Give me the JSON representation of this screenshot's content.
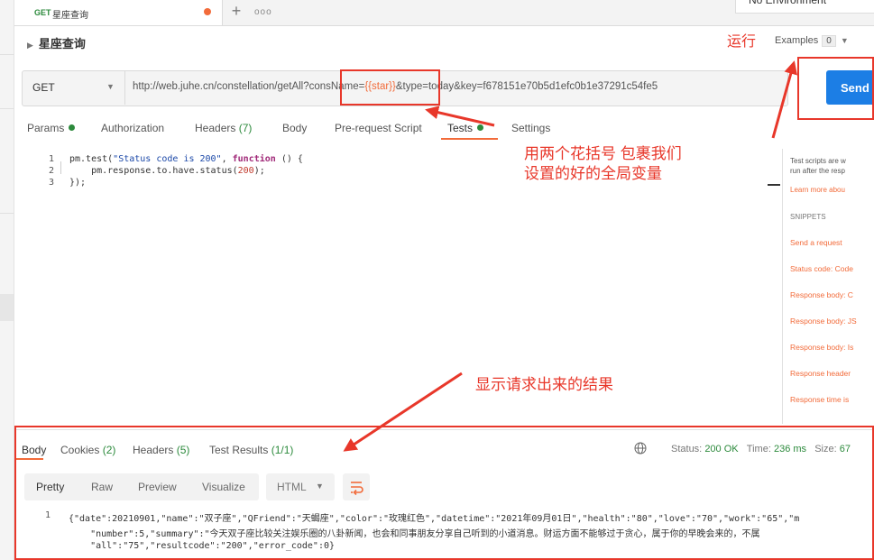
{
  "tab": {
    "method": "GET",
    "name": "星座查询"
  },
  "environment": "No Environment",
  "request": {
    "title": "星座查询",
    "examples_label": "Examples",
    "examples_count": "0",
    "method": "GET",
    "url_before": "http://web.juhe.cn/constellation/getAll?consName=",
    "url_var": "{{star}}",
    "url_after": "&type=today&key=f678151e70b5d1efc0b1e37291c54fe5",
    "send_label": "Send"
  },
  "subtabs": {
    "params": "Params",
    "authorization": "Authorization",
    "headers": "Headers",
    "headers_count": "(7)",
    "body": "Body",
    "prescript": "Pre-request Script",
    "tests": "Tests",
    "settings": "Settings"
  },
  "editor": {
    "line_numbers": [
      "1",
      "2",
      "3"
    ]
  },
  "right_panel": {
    "desc_line1": "Test scripts are w",
    "desc_line2": "run after the resp",
    "learn": "Learn more abou",
    "snippets_heading": "SNIPPETS",
    "snippets": [
      "Send a request",
      "Status code: Code",
      "Response body: C",
      "Response body: JS",
      "Response body: Is",
      "Response header",
      "Response time is"
    ]
  },
  "annotations": {
    "run": "运行",
    "braces_line1": "用两个花括号 包裹我们",
    "braces_line2": "设置的好的全局变量",
    "result": "显示请求出来的结果"
  },
  "response": {
    "tabs": {
      "body": "Body",
      "cookies": "Cookies",
      "cookies_count": "(2)",
      "headers": "Headers",
      "headers_count": "(5)",
      "test_results": "Test Results",
      "test_results_count": "(1/1)"
    },
    "status_label": "Status:",
    "status_value": "200 OK",
    "time_label": "Time:",
    "time_value": "236 ms",
    "size_label": "Size:",
    "size_value": "67",
    "formats": [
      "Pretty",
      "Raw",
      "Preview",
      "Visualize"
    ],
    "language": "HTML",
    "line_number": "1",
    "lines": [
      "{\"date\":20210901,\"name\":\"双子座\",\"QFriend\":\"天蝎座\",\"color\":\"玫瑰红色\",\"datetime\":\"2021年09月01日\",\"health\":\"80\",\"love\":\"70\",\"work\":\"65\",\"m",
      "    \"number\":5,\"summary\":\"今天双子座比较关注娱乐圈的八卦新闻，也会和同事朋友分享自己听到的小道消息。财运方面不能够过于贪心，属于你的早晚会来的，不属",
      "    \"all\":\"75\",\"resultcode\":\"200\",\"error_code\":0}"
    ]
  }
}
